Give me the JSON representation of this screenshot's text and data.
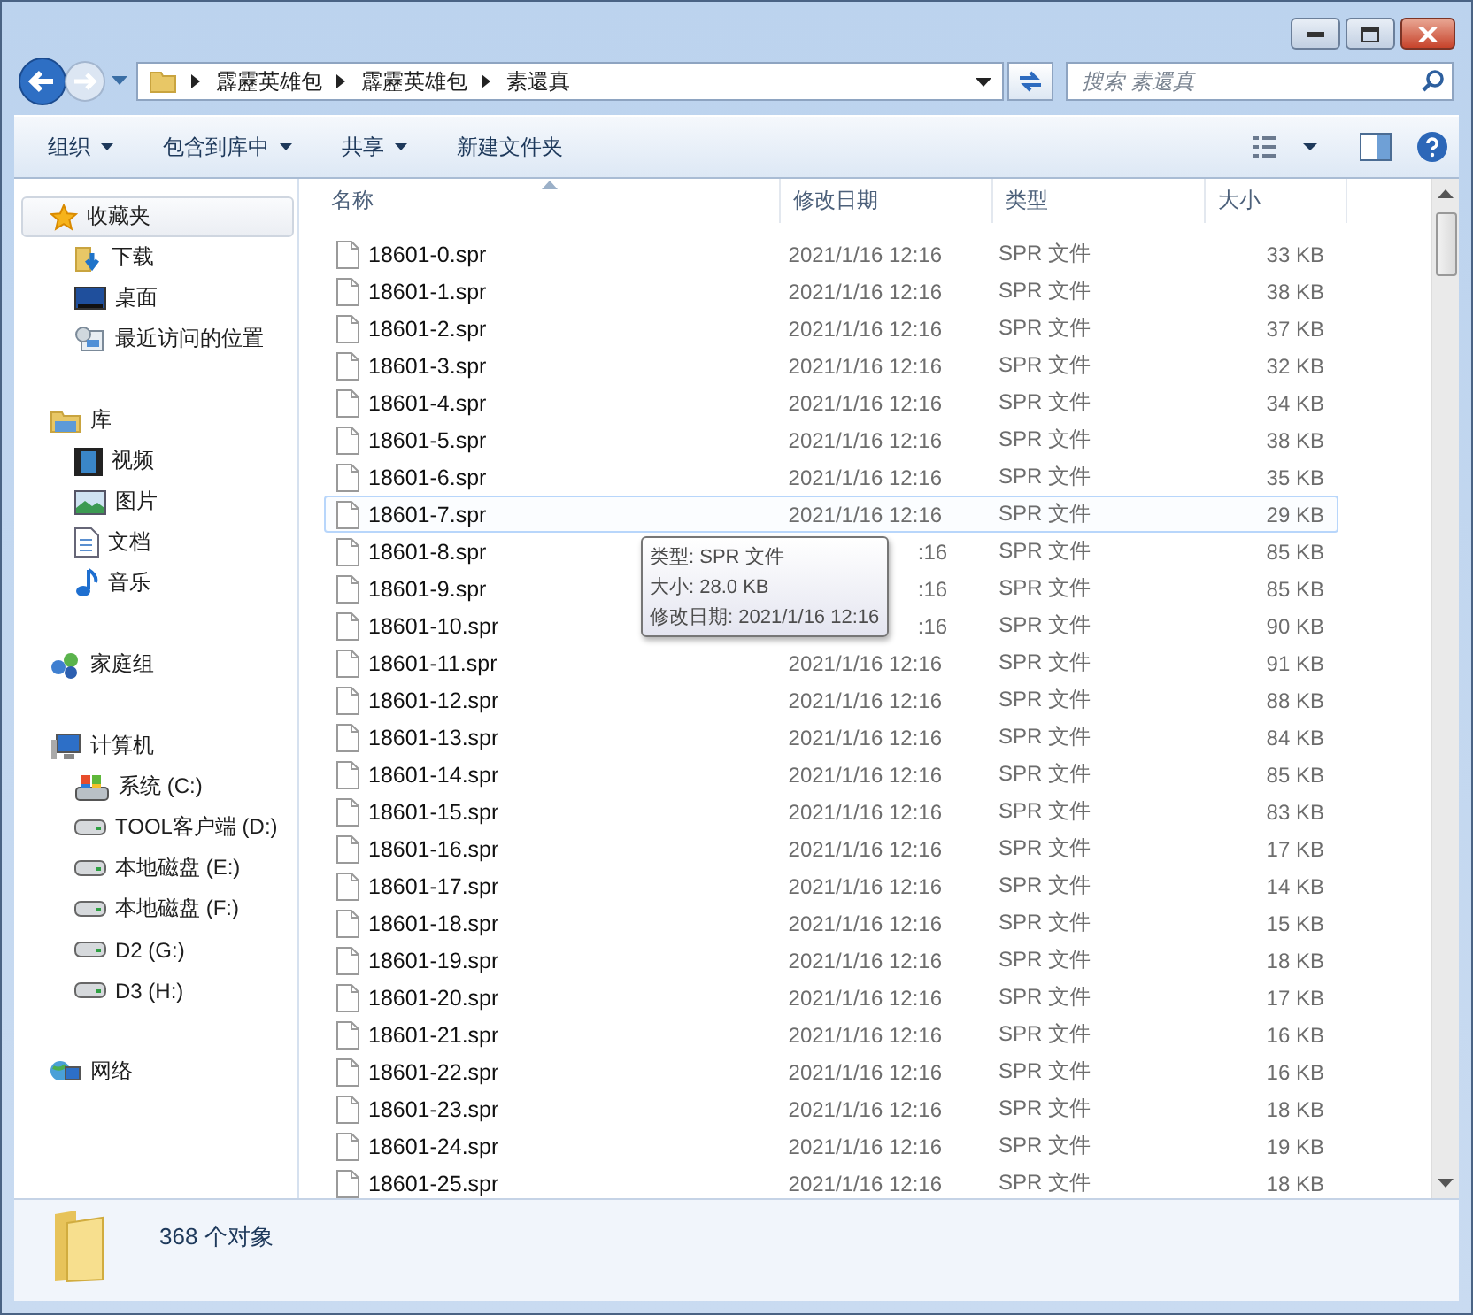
{
  "address": {
    "crumbs": [
      "霹靂英雄包",
      "霹靂英雄包",
      "素還真"
    ]
  },
  "search": {
    "placeholder": "搜索 素還真"
  },
  "toolbar": {
    "items": [
      {
        "label": "组织",
        "menu": true
      },
      {
        "label": "包含到库中",
        "menu": true
      },
      {
        "label": "共享",
        "menu": true
      },
      {
        "label": "新建文件夹",
        "menu": false
      }
    ]
  },
  "sidebar": {
    "sections": [
      {
        "label": "收藏夹",
        "kind": "favorites",
        "selected": true,
        "children": [
          {
            "label": "下载",
            "kind": "downloads",
            "selected": false
          },
          {
            "label": "桌面",
            "kind": "desktop",
            "selected": false
          },
          {
            "label": "最近访问的位置",
            "kind": "recent",
            "selected": false
          }
        ]
      },
      {
        "label": "库",
        "kind": "library",
        "selected": false,
        "children": [
          {
            "label": "视频",
            "kind": "video",
            "selected": false
          },
          {
            "label": "图片",
            "kind": "picture",
            "selected": false
          },
          {
            "label": "文档",
            "kind": "document",
            "selected": false
          },
          {
            "label": "音乐",
            "kind": "music",
            "selected": false
          }
        ]
      },
      {
        "label": "家庭组",
        "kind": "homegroup",
        "selected": false
      },
      {
        "label": "计算机",
        "kind": "computer",
        "selected": false,
        "children": [
          {
            "label": "系统 (C:)",
            "kind": "system-drive",
            "selected": false
          },
          {
            "label": "TOOL客户端 (D:)",
            "kind": "drive",
            "selected": false
          },
          {
            "label": "本地磁盘 (E:)",
            "kind": "drive",
            "selected": false
          },
          {
            "label": "本地磁盘 (F:)",
            "kind": "drive",
            "selected": false
          },
          {
            "label": "D2 (G:)",
            "kind": "drive",
            "selected": false
          },
          {
            "label": "D3 (H:)",
            "kind": "drive",
            "selected": false
          }
        ]
      },
      {
        "label": "网络",
        "kind": "network",
        "selected": false
      }
    ]
  },
  "table": {
    "columns": [
      {
        "label": "名称",
        "sorted": true
      },
      {
        "label": "修改日期",
        "sorted": false
      },
      {
        "label": "类型",
        "sorted": false
      },
      {
        "label": "大小",
        "sorted": false
      }
    ],
    "rows": [
      {
        "name": "18601-0.spr",
        "date": "2021/1/16 12:16",
        "type": "SPR 文件",
        "size": "33 KB",
        "hovered": false,
        "selected": false,
        "date_covered": false
      },
      {
        "name": "18601-1.spr",
        "date": "2021/1/16 12:16",
        "type": "SPR 文件",
        "size": "38 KB",
        "hovered": false,
        "selected": false,
        "date_covered": false
      },
      {
        "name": "18601-2.spr",
        "date": "2021/1/16 12:16",
        "type": "SPR 文件",
        "size": "37 KB",
        "hovered": false,
        "selected": false,
        "date_covered": false
      },
      {
        "name": "18601-3.spr",
        "date": "2021/1/16 12:16",
        "type": "SPR 文件",
        "size": "32 KB",
        "hovered": false,
        "selected": false,
        "date_covered": false
      },
      {
        "name": "18601-4.spr",
        "date": "2021/1/16 12:16",
        "type": "SPR 文件",
        "size": "34 KB",
        "hovered": false,
        "selected": false,
        "date_covered": false
      },
      {
        "name": "18601-5.spr",
        "date": "2021/1/16 12:16",
        "type": "SPR 文件",
        "size": "38 KB",
        "hovered": false,
        "selected": false,
        "date_covered": false
      },
      {
        "name": "18601-6.spr",
        "date": "2021/1/16 12:16",
        "type": "SPR 文件",
        "size": "35 KB",
        "hovered": false,
        "selected": false,
        "date_covered": false
      },
      {
        "name": "18601-7.spr",
        "date": "2021/1/16 12:16",
        "type": "SPR 文件",
        "size": "29 KB",
        "hovered": true,
        "selected": false,
        "date_covered": false
      },
      {
        "name": "18601-8.spr",
        "date": ":16",
        "type": "SPR 文件",
        "size": "85 KB",
        "hovered": false,
        "selected": false,
        "date_covered": true
      },
      {
        "name": "18601-9.spr",
        "date": ":16",
        "type": "SPR 文件",
        "size": "85 KB",
        "hovered": false,
        "selected": false,
        "date_covered": true
      },
      {
        "name": "18601-10.spr",
        "date": ":16",
        "type": "SPR 文件",
        "size": "90 KB",
        "hovered": false,
        "selected": false,
        "date_covered": true
      },
      {
        "name": "18601-11.spr",
        "date": "2021/1/16 12:16",
        "type": "SPR 文件",
        "size": "91 KB",
        "hovered": false,
        "selected": false,
        "date_covered": false
      },
      {
        "name": "18601-12.spr",
        "date": "2021/1/16 12:16",
        "type": "SPR 文件",
        "size": "88 KB",
        "hovered": false,
        "selected": false,
        "date_covered": false
      },
      {
        "name": "18601-13.spr",
        "date": "2021/1/16 12:16",
        "type": "SPR 文件",
        "size": "84 KB",
        "hovered": false,
        "selected": false,
        "date_covered": false
      },
      {
        "name": "18601-14.spr",
        "date": "2021/1/16 12:16",
        "type": "SPR 文件",
        "size": "85 KB",
        "hovered": false,
        "selected": false,
        "date_covered": false
      },
      {
        "name": "18601-15.spr",
        "date": "2021/1/16 12:16",
        "type": "SPR 文件",
        "size": "83 KB",
        "hovered": false,
        "selected": false,
        "date_covered": false
      },
      {
        "name": "18601-16.spr",
        "date": "2021/1/16 12:16",
        "type": "SPR 文件",
        "size": "17 KB",
        "hovered": false,
        "selected": false,
        "date_covered": false
      },
      {
        "name": "18601-17.spr",
        "date": "2021/1/16 12:16",
        "type": "SPR 文件",
        "size": "14 KB",
        "hovered": false,
        "selected": false,
        "date_covered": false
      },
      {
        "name": "18601-18.spr",
        "date": "2021/1/16 12:16",
        "type": "SPR 文件",
        "size": "15 KB",
        "hovered": false,
        "selected": false,
        "date_covered": false
      },
      {
        "name": "18601-19.spr",
        "date": "2021/1/16 12:16",
        "type": "SPR 文件",
        "size": "18 KB",
        "hovered": false,
        "selected": false,
        "date_covered": false
      },
      {
        "name": "18601-20.spr",
        "date": "2021/1/16 12:16",
        "type": "SPR 文件",
        "size": "17 KB",
        "hovered": false,
        "selected": false,
        "date_covered": false
      },
      {
        "name": "18601-21.spr",
        "date": "2021/1/16 12:16",
        "type": "SPR 文件",
        "size": "16 KB",
        "hovered": false,
        "selected": false,
        "date_covered": false
      },
      {
        "name": "18601-22.spr",
        "date": "2021/1/16 12:16",
        "type": "SPR 文件",
        "size": "16 KB",
        "hovered": false,
        "selected": false,
        "date_covered": false
      },
      {
        "name": "18601-23.spr",
        "date": "2021/1/16 12:16",
        "type": "SPR 文件",
        "size": "18 KB",
        "hovered": false,
        "selected": false,
        "date_covered": false
      },
      {
        "name": "18601-24.spr",
        "date": "2021/1/16 12:16",
        "type": "SPR 文件",
        "size": "19 KB",
        "hovered": false,
        "selected": false,
        "date_covered": false
      },
      {
        "name": "18601-25.spr",
        "date": "2021/1/16 12:16",
        "type": "SPR 文件",
        "size": "18 KB",
        "hovered": false,
        "selected": false,
        "date_covered": false
      }
    ]
  },
  "tooltip": {
    "lines": [
      "类型: SPR 文件",
      "大小: 28.0 KB",
      "修改日期: 2021/1/16 12:16"
    ]
  },
  "status_bar": {
    "count": "368 个对象"
  }
}
